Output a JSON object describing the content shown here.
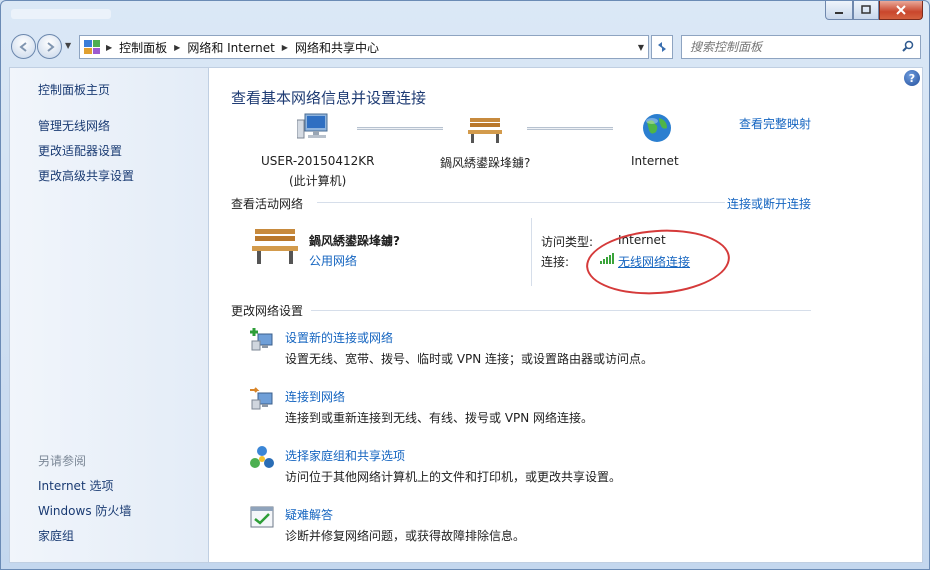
{
  "window": {
    "title": ""
  },
  "nav": {
    "breadcrumb": [
      "控制面板",
      "网络和 Internet",
      "网络和共享中心"
    ],
    "search_placeholder": "搜索控制面板"
  },
  "sidebar": {
    "home": "控制面板主页",
    "links": [
      "管理无线网络",
      "更改适配器设置",
      "更改高级共享设置"
    ],
    "see_also_header": "另请参阅",
    "see_also": [
      "Internet 选项",
      "Windows 防火墙",
      "家庭组"
    ]
  },
  "main": {
    "title": "查看基本网络信息并设置连接",
    "map_link": "查看完整映射",
    "map": {
      "computer_name": "USER-20150412KR",
      "computer_sub": "(此计算机)",
      "network_name": "鍋风綉鍙跺埄鐪?",
      "internet": "Internet"
    },
    "active_header": "查看活动网络",
    "connect_link": "连接或断开连接",
    "active": {
      "network_name": "鍋风綉鍙跺埄鐪?",
      "network_type": "公用网络",
      "access_label": "访问类型:",
      "access_value": "Internet",
      "conn_label": "连接:",
      "conn_value": "无线网络连接"
    },
    "change_header": "更改网络设置",
    "tasks": [
      {
        "title": "设置新的连接或网络",
        "desc": "设置无线、宽带、拨号、临时或 VPN 连接；或设置路由器或访问点。"
      },
      {
        "title": "连接到网络",
        "desc": "连接到或重新连接到无线、有线、拨号或 VPN 网络连接。"
      },
      {
        "title": "选择家庭组和共享选项",
        "desc": "访问位于其他网络计算机上的文件和打印机，或更改共享设置。"
      },
      {
        "title": "疑难解答",
        "desc": "诊断并修复网络问题，或获得故障排除信息。"
      }
    ]
  },
  "colors": {
    "link": "#1565c0",
    "heading": "#1e3b73",
    "annotation": "#d53a3a"
  }
}
